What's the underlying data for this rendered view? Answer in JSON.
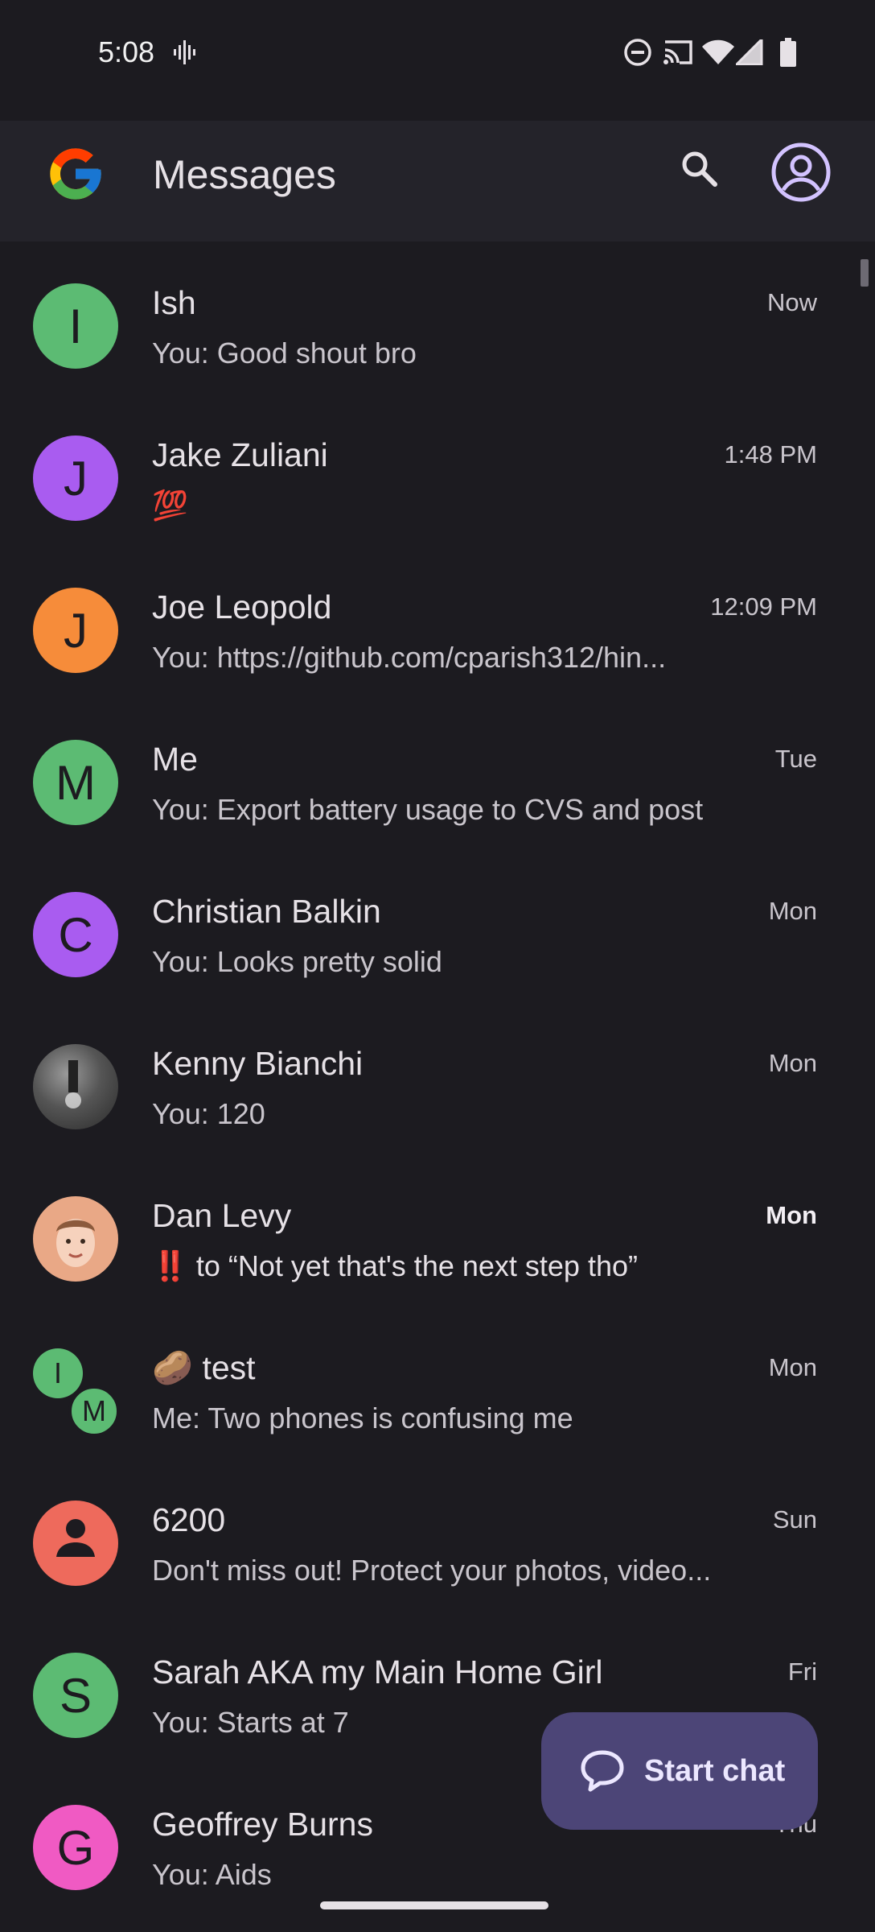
{
  "status_bar": {
    "time": "5:08",
    "icons": [
      "audio-activity-icon",
      "do-not-disturb-icon",
      "cast-icon",
      "wifi-icon",
      "signal-icon",
      "battery-icon"
    ]
  },
  "app_bar": {
    "title": "Messages",
    "search_icon": "search-icon",
    "account_icon": "account-circle-icon"
  },
  "conversations": [
    {
      "name": "Ish",
      "snippet": "You: Good shout bro",
      "time": "Now",
      "avatar_letter": "I",
      "avatar_color": "#5cbb73"
    },
    {
      "name": "Jake Zuliani",
      "snippet": "💯",
      "time": "1:48 PM",
      "avatar_letter": "J",
      "avatar_color": "#a95cf0"
    },
    {
      "name": "Joe Leopold",
      "snippet": "You: https://github.com/cparish312/hin...",
      "time": "12:09 PM",
      "avatar_letter": "J",
      "avatar_color": "#f68c3a"
    },
    {
      "name": "Me",
      "snippet": "You: Export battery usage to CVS and post",
      "time": "Tue",
      "avatar_letter": "M",
      "avatar_color": "#5cbb73"
    },
    {
      "name": "Christian Balkin",
      "snippet": "You: Looks pretty solid",
      "time": "Mon",
      "avatar_letter": "C",
      "avatar_color": "#a95cf0"
    },
    {
      "name": "Kenny Bianchi",
      "snippet": "You: 120",
      "time": "Mon",
      "avatar_letter": "",
      "avatar_color": "#6b6b6b"
    },
    {
      "name": "Dan Levy",
      "snippet": "‼️ to “Not yet that's the next step tho”",
      "time": "Mon",
      "avatar_letter": "",
      "avatar_color": "#e9a886"
    },
    {
      "name": "🥔 test",
      "snippet": "Me: Two phones is confusing me",
      "time": "Mon",
      "group_letters": [
        "I",
        "M"
      ]
    },
    {
      "name": "6200",
      "snippet": "Don't miss out! Protect your photos, video...",
      "time": "Sun",
      "avatar_letter": "",
      "avatar_color": "#ee6a5c"
    },
    {
      "name": "Sarah AKA my Main Home Girl",
      "snippet": "You: Starts at 7",
      "time": "Fri",
      "avatar_letter": "S",
      "avatar_color": "#5cbb73"
    },
    {
      "name": "Geoffrey Burns",
      "snippet": "You: Aids",
      "time": "Thu",
      "avatar_letter": "G",
      "avatar_color": "#f05ac3"
    }
  ],
  "fab": {
    "label": "Start chat",
    "icon": "chat-bubble-icon"
  }
}
